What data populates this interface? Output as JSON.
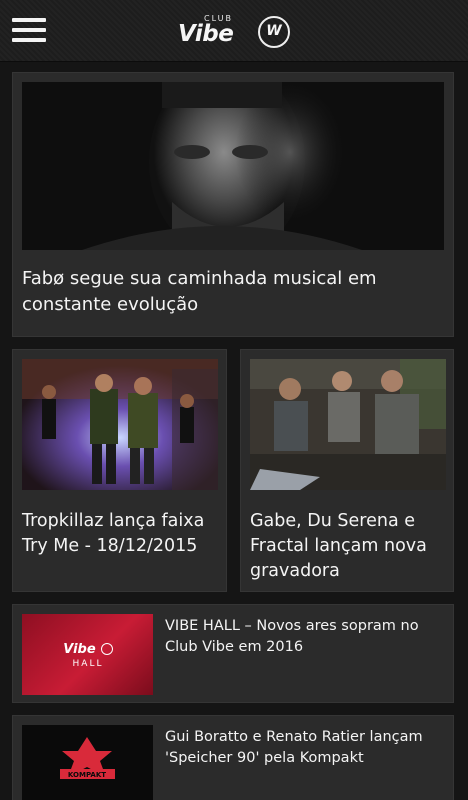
{
  "brand": {
    "club": "CLUB",
    "name": "Vibe",
    "badge": "W"
  },
  "header": {
    "menu_icon": "hamburger-icon"
  },
  "featured": {
    "title": "Fabø segue sua caminhada musical em constante evolução"
  },
  "grid": [
    {
      "title": "Tropkillaz lança faixa Try Me - 18/12/2015"
    },
    {
      "title": "Gabe, Du Serena e Fractal lançam nova gravadora"
    }
  ],
  "list": [
    {
      "title": "VIBE HALL – Novos ares sopram no Club Vibe em 2016",
      "thumb_logo": "Vibe",
      "thumb_label": "HALL"
    },
    {
      "title": "Gui Boratto e Renato Ratier lançam 'Speicher 90' pela Kompakt",
      "thumb_label": "KOMPAKT"
    }
  ],
  "colors": {
    "background": "#151515",
    "card": "#2b2b2b",
    "topbar": "#1d1d1d",
    "accent_red": "#b0152a"
  }
}
